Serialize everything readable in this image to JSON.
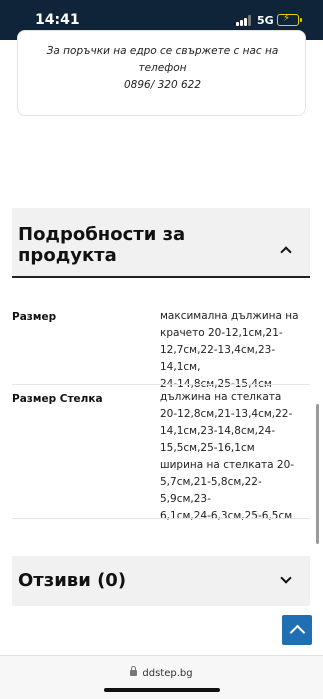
{
  "status_bar": {
    "time": "14:41",
    "network": "5G"
  },
  "notice": {
    "lines": [
      "За поръчки на едро се свържете с нас на",
      "телефон",
      "0896/ 320 622"
    ]
  },
  "details": {
    "title_line1": "Подробности за",
    "title_line2": "продукта",
    "rows": [
      {
        "label": "Размер",
        "value_lines": [
          "максимална дължина на",
          "крачето 20-12,1см,21-",
          "12,7см,22-13,4см,23-14,1см,",
          "24-14,8см,25-15,4см"
        ]
      },
      {
        "label": "Размер Стелка",
        "value_lines": [
          "дължина на стелката",
          "20-12,8см,21-13,4см,22-",
          "14,1см,23-14,8см,24-",
          "15,5см,25-16,1см",
          "ширина на стелката 20-",
          "5,7см,21-5,8см,22-5,9см,23-",
          "6,1см,24-6,3см,25-6,5см"
        ]
      }
    ]
  },
  "reviews": {
    "title": "Отзиви (0)"
  },
  "browser": {
    "url": "ddstep.bg"
  },
  "colors": {
    "status_bar": "#0f2438",
    "accent": "#1f6fb2",
    "panel_bg": "#f1f1f1"
  }
}
